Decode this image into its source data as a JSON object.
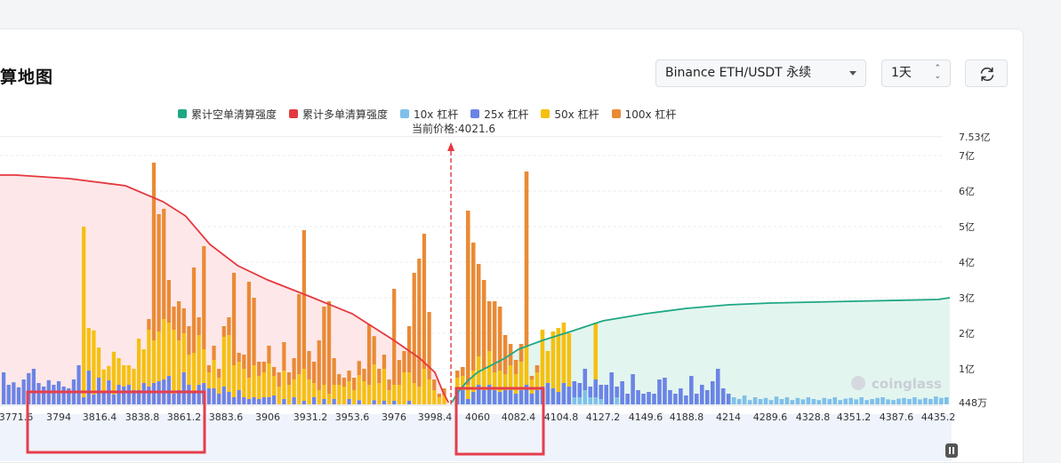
{
  "page": {
    "title": "算地图",
    "exchange_select": "Binance ETH/USDT 永续",
    "interval_select": "1天",
    "current_price_label": "当前价格:4021.6",
    "watermark": "coinglass"
  },
  "colors": {
    "short_cum": "#1ea784",
    "long_cum": "#e5383f",
    "lev10": "#7fc0ea",
    "lev25": "#6b84e6",
    "lev50": "#f5c00f",
    "lev100": "#ea8a35",
    "long_fill": "#fde7e8",
    "short_fill": "#e3f5ef",
    "highlight": "#e53e4c"
  },
  "chart_data": {
    "type": "bar",
    "current_price": 4021.6,
    "legend": [
      "累计空单清算强度",
      "累计多单清算强度",
      "10x 杠杆",
      "25x 杠杆",
      "50x 杠杆",
      "100x 杠杆"
    ],
    "legend_position": "top-center",
    "x_tick_labels": [
      "3771.6",
      "3794",
      "3816.4",
      "3838.8",
      "3861.2",
      "3883.6",
      "3906",
      "3931.2",
      "3953.6",
      "3976",
      "3998.4",
      "4060",
      "4082.4",
      "4104.8",
      "4127.2",
      "4149.6",
      "4188.8",
      "4214",
      "4289.6",
      "4328.8",
      "4351.2",
      "4387.6",
      "4435.2"
    ],
    "y_tick_labels": [
      "448万",
      "1亿",
      "2亿",
      "3亿",
      "4亿",
      "5亿",
      "6亿",
      "7亿",
      "7.53亿"
    ],
    "ylim_yi": [
      0,
      7.53
    ],
    "bars_yi": [
      {
        "l25": 0.9
      },
      {
        "l25": 0.55
      },
      {
        "l25": 0.62
      },
      {
        "l25": 0.48
      },
      {
        "l25": 0.7
      },
      {
        "l25": 0.88
      },
      {
        "l25": 1.0
      },
      {
        "l25": 0.6
      },
      {
        "l25": 0.5
      },
      {
        "l25": 0.68
      },
      {
        "l25": 0.55
      },
      {
        "l25": 0.65
      },
      {
        "l25": 0.5
      },
      {
        "l25": 0.45
      },
      {
        "l25": 0.7
      },
      {
        "l25": 1.1
      },
      {
        "l25": 0.2,
        "l50": 4.8
      },
      {
        "l25": 0.95,
        "l50": 1.2
      },
      {
        "l25": 0.28,
        "l50": 1.8
      },
      {
        "l25": 0.75,
        "l50": 0.85
      },
      {
        "l25": 0.38,
        "l50": 0.6
      },
      {
        "l25": 0.68,
        "l50": 0.4
      },
      {
        "l25": 0.28,
        "l50": 1.2
      },
      {
        "l25": 0.55,
        "l50": 0.75
      },
      {
        "l25": 0.5,
        "l50": 0.6
      },
      {
        "l25": 0.55,
        "l50": 0.55
      },
      {
        "l25": 0.4,
        "l50": 0.6
      },
      {
        "l25": 0.4,
        "l50": 1.45
      },
      {
        "l25": 0.6,
        "l50": 0.95
      },
      {
        "l25": 0.5,
        "l50": 1.6,
        "l100": 0.3
      },
      {
        "l25": 0.6,
        "l50": 1.2,
        "l100": 5.0
      },
      {
        "l25": 0.65,
        "l50": 1.4,
        "l100": 3.3
      },
      {
        "l25": 0.7,
        "l50": 1.7,
        "l100": 3.1
      },
      {
        "l25": 0.8,
        "l50": 1.5,
        "l100": 1.2
      },
      {
        "l25": 0.3,
        "l50": 1.8,
        "l100": 0.65
      },
      {
        "l25": 0.4,
        "l50": 1.4,
        "l100": 1.1
      },
      {
        "l25": 0.9,
        "l50": 1.1,
        "l100": 0.7
      },
      {
        "l25": 0.55,
        "l50": 0.85,
        "l100": 0.8
      },
      {
        "l25": 0.35,
        "l50": 1.1,
        "l100": 2.4
      },
      {
        "l25": 0.55,
        "l50": 1.4,
        "l100": 0.5
      },
      {
        "l25": 0.6,
        "l50": 0.95,
        "l100": 2.9
      },
      {
        "l25": 0.45,
        "l50": 0.45,
        "l100": 0.2
      },
      {
        "l25": 0.45,
        "l50": 0.8,
        "l100": 0.4
      },
      {
        "l25": 0.3,
        "l50": 0.45,
        "l100": 0.25
      },
      {
        "l25": 0.5,
        "l50": 1.4,
        "l100": 0.3
      },
      {
        "l25": 0.35,
        "l50": 1.6,
        "l100": 0.5
      },
      {
        "l25": 0.2,
        "l50": 0.9,
        "l100": 2.6
      },
      {
        "l25": 0.4,
        "l50": 0.8,
        "l100": 0.25
      },
      {
        "l25": 0.2,
        "l50": 0.8,
        "l100": 0.4
      },
      {
        "l25": 0.15,
        "l50": 0.6,
        "l100": 2.7
      },
      {
        "l25": 0.2,
        "l50": 0.9,
        "l100": 1.9
      },
      {
        "l25": 0.15,
        "l50": 0.65,
        "l100": 0.4
      },
      {
        "l25": 0.2,
        "l50": 0.7,
        "l100": 0.3
      },
      {
        "l25": 0.2,
        "l50": 0.95,
        "l100": 0.5
      },
      {
        "l25": 0.25,
        "l50": 0.55,
        "l100": 0.25
      },
      {
        "l50": 0.5,
        "l100": 0.4
      },
      {
        "l25": 0.15,
        "l50": 0.8,
        "l100": 0.8
      },
      {
        "l50": 0.55,
        "l100": 0.35
      },
      {
        "l25": 0.2,
        "l50": 0.5,
        "l100": 0.6
      },
      {
        "l50": 0.85,
        "l100": 2.25
      },
      {
        "l25": 0.1,
        "l50": 0.9,
        "l100": 3.9
      },
      {
        "l50": 0.7,
        "l100": 0.8
      },
      {
        "l25": 0.2,
        "l50": 0.4,
        "l100": 0.6
      },
      {
        "l50": 0.4,
        "l100": 1.4
      },
      {
        "l25": 0.15,
        "l50": 0.4,
        "l100": 2.2
      },
      {
        "l50": 0.3,
        "l100": 2.6
      },
      {
        "l25": 0.15,
        "l50": 0.4,
        "l100": 0.75
      },
      {
        "l50": 0.55,
        "l100": 0.3
      },
      {
        "l50": 0.5,
        "l100": 0.25
      },
      {
        "l25": 0.15,
        "l50": 0.5,
        "l100": 0.3
      },
      {
        "l50": 0.4,
        "l100": 0.35
      },
      {
        "l25": 0.12,
        "l50": 0.7,
        "l100": 0.4
      },
      {
        "l50": 0.65,
        "l100": 0.35
      },
      {
        "l50": 0.55,
        "l100": 1.7
      },
      {
        "l25": 0.12,
        "l50": 1.0,
        "l100": 0.8
      },
      {
        "l50": 0.6,
        "l100": 0.4
      },
      {
        "l25": 0.1,
        "l50": 0.9,
        "l100": 0.4
      },
      {
        "l50": 0.4,
        "l100": 0.3
      },
      {
        "l25": 0.1,
        "l50": 0.45,
        "l100": 2.7
      },
      {
        "l50": 0.55,
        "l100": 0.7
      },
      {
        "l50": 0.9,
        "l100": 0.6
      },
      {
        "l25": 0.1,
        "l50": 0.8,
        "l100": 1.3
      },
      {
        "l50": 0.6,
        "l100": 3.1
      },
      {
        "l50": 0.5,
        "l100": 3.6
      },
      {
        "l50": 1.0,
        "l100": 3.8
      },
      {
        "l50": 0.7,
        "l100": 1.9
      },
      {
        "l50": 0.4,
        "l100": 0.3
      },
      {
        "l50": 0.2,
        "l100": 0.1
      },
      {
        "l50": 0.25,
        "l100": 0.2
      },
      {
        "s25": 0.4,
        "s50": 0.35,
        "s100": 0.2
      },
      {
        "s25": 0.4,
        "s50": 0.4,
        "s100": 0.25
      },
      {
        "s25": 0.15,
        "s50": 0.4,
        "s100": 4.9
      },
      {
        "s25": 0.35,
        "s50": 0.6,
        "s100": 3.6
      },
      {
        "s25": 0.55,
        "s50": 0.8,
        "s100": 2.6
      },
      {
        "s25": 0.4,
        "s50": 0.6,
        "s100": 2.5
      },
      {
        "s25": 0.55,
        "s50": 0.95,
        "s100": 1.4
      },
      {
        "s25": 0.4,
        "s50": 0.5,
        "s100": 2.0
      },
      {
        "s25": 0.35,
        "s50": 0.6,
        "s100": 1.8
      },
      {
        "s25": 0.4,
        "s50": 0.45,
        "s100": 1.1
      },
      {
        "s25": 0.4,
        "s50": 0.7,
        "s100": 0.6
      },
      {
        "s25": 0.3,
        "s50": 0.55,
        "s100": 0.4
      },
      {
        "s25": 0.4,
        "s50": 0.8,
        "s100": 0.5
      },
      {
        "s25": 0.55,
        "s50": 1.1,
        "s100": 4.9
      },
      {
        "s25": 0.3,
        "s50": 0.4,
        "s100": 0.1
      },
      {
        "s25": 0.4,
        "s50": 0.5,
        "s100": 0.2
      },
      {
        "s25": 0.5,
        "s50": 1.6
      },
      {
        "s25": 0.6,
        "s50": 0.9
      },
      {
        "s25": 0.45,
        "s50": 1.6
      },
      {
        "s25": 0.35,
        "s50": 1.8
      },
      {
        "s25": 0.6,
        "s50": 1.7
      },
      {
        "s25": 0.5,
        "s50": 1.5
      },
      {
        "s25": 0.45,
        "s10": 0.2
      },
      {
        "s25": 0.4,
        "s10": 0.2
      },
      {
        "s25": 0.6,
        "s10": 0.4
      },
      {
        "s25": 0.3,
        "s10": 0.2
      },
      {
        "s25": 0.5,
        "s50": 1.6,
        "s10": 0.2
      },
      {
        "s25": 0.4,
        "s10": 0.15
      },
      {
        "s25": 0.55
      },
      {
        "s25": 0.9
      },
      {
        "s25": 0.3,
        "s10": 0.2
      },
      {
        "s25": 0.65
      },
      {
        "s25": 0.3
      },
      {
        "s25": 0.85
      },
      {
        "s25": 0.4
      },
      {
        "s25": 0.3
      },
      {
        "s25": 0.35
      },
      {
        "s25": 0.3
      },
      {
        "s25": 0.7
      },
      {
        "s25": 0.75
      },
      {
        "s25": 0.4
      },
      {
        "s25": 0.3
      },
      {
        "s25": 0.45
      },
      {
        "s25": 0.25
      },
      {
        "s25": 0.8
      },
      {
        "s25": 0.3
      },
      {
        "s25": 0.55
      },
      {
        "s25": 0.4
      },
      {
        "s25": 0.65
      },
      {
        "s25": 1.0
      },
      {
        "s25": 0.45
      },
      {
        "s25": 0.3
      },
      {
        "s10": 0.2
      },
      {
        "s10": 0.15
      },
      {
        "s10": 0.25
      },
      {
        "s10": 0.12
      },
      {
        "s10": 0.2
      },
      {
        "s10": 0.15
      },
      {
        "s10": 0.18
      },
      {
        "s10": 0.12
      },
      {
        "s10": 0.22
      },
      {
        "s10": 0.15
      },
      {
        "s10": 0.2
      },
      {
        "s10": 0.12
      },
      {
        "s10": 0.18
      },
      {
        "s10": 0.14
      },
      {
        "s10": 0.2
      },
      {
        "s10": 0.15
      },
      {
        "s10": 0.12
      },
      {
        "s10": 0.18
      },
      {
        "s10": 0.15
      },
      {
        "s10": 0.2
      },
      {
        "s10": 0.12
      },
      {
        "s10": 0.16
      },
      {
        "s10": 0.18
      },
      {
        "s10": 0.14
      },
      {
        "s10": 0.2
      },
      {
        "s10": 0.12
      },
      {
        "s10": 0.15
      },
      {
        "s10": 0.18
      },
      {
        "s10": 0.2
      },
      {
        "s10": 0.14
      },
      {
        "s10": 0.12
      },
      {
        "s10": 0.16
      },
      {
        "s10": 0.18
      },
      {
        "s10": 0.15
      },
      {
        "s10": 0.2
      },
      {
        "s10": 0.14
      },
      {
        "s10": 0.18
      },
      {
        "s10": 0.15
      },
      {
        "s10": 0.22
      },
      {
        "s10": 0.18
      },
      {
        "s10": 0.2
      }
    ],
    "long_cum_curve_yi": [
      [
        3771.6,
        6.45
      ],
      [
        3800,
        6.35
      ],
      [
        3830,
        6.15
      ],
      [
        3850,
        5.7
      ],
      [
        3862,
        5.3
      ],
      [
        3875,
        4.5
      ],
      [
        3890,
        3.9
      ],
      [
        3906,
        3.5
      ],
      [
        3930,
        3.05
      ],
      [
        3953.6,
        2.55
      ],
      [
        3976,
        1.8
      ],
      [
        3990,
        1.3
      ],
      [
        3998.4,
        0.9
      ],
      [
        4010,
        0.35
      ],
      [
        4018,
        0.05
      ]
    ],
    "short_cum_curve_yi": [
      [
        4023,
        0.05
      ],
      [
        4030,
        0.3
      ],
      [
        4045,
        0.65
      ],
      [
        4060,
        0.9
      ],
      [
        4075,
        1.3
      ],
      [
        4082.4,
        1.55
      ],
      [
        4095,
        1.8
      ],
      [
        4110,
        2.05
      ],
      [
        4127.2,
        2.35
      ],
      [
        4149.6,
        2.55
      ],
      [
        4188.8,
        2.7
      ],
      [
        4214,
        2.8
      ],
      [
        4289.6,
        2.85
      ],
      [
        4351.2,
        2.9
      ],
      [
        4435.2,
        2.95
      ],
      [
        4470,
        3.0
      ]
    ]
  }
}
